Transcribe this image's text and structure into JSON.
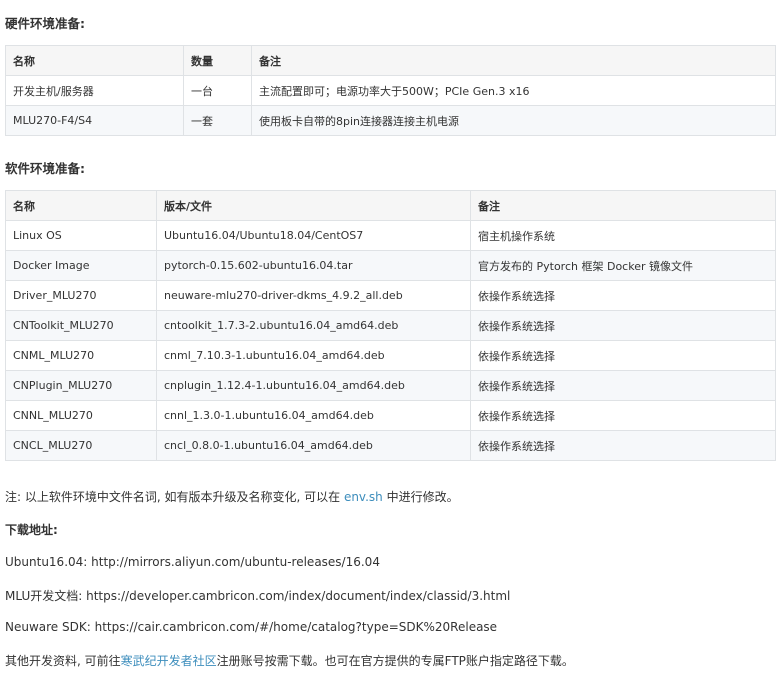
{
  "hardware": {
    "title": "硬件环境准备:",
    "columns": [
      "名称",
      "数量",
      "备注"
    ],
    "rows": [
      [
        "开发主机/服务器",
        "一台",
        "主流配置即可；电源功率大于500W；PCIe Gen.3 x16"
      ],
      [
        "MLU270-F4/S4",
        "一套",
        "使用板卡自带的8pin连接器连接主机电源"
      ]
    ]
  },
  "software": {
    "title": "软件环境准备:",
    "columns": [
      "名称",
      "版本/文件",
      "备注"
    ],
    "rows": [
      [
        "Linux OS",
        "Ubuntu16.04/Ubuntu18.04/CentOS7",
        "宿主机操作系统"
      ],
      [
        "Docker Image",
        "pytorch-0.15.602-ubuntu16.04.tar",
        "官方发布的 Pytorch 框架 Docker 镜像文件"
      ],
      [
        "Driver_MLU270",
        "neuware-mlu270-driver-dkms_4.9.2_all.deb",
        "依操作系统选择"
      ],
      [
        "CNToolkit_MLU270",
        "cntoolkit_1.7.3-2.ubuntu16.04_amd64.deb",
        "依操作系统选择"
      ],
      [
        "CNML_MLU270",
        "cnml_7.10.3-1.ubuntu16.04_amd64.deb",
        "依操作系统选择"
      ],
      [
        "CNPlugin_MLU270",
        "cnplugin_1.12.4-1.ubuntu16.04_amd64.deb",
        "依操作系统选择"
      ],
      [
        "CNNL_MLU270",
        "cnnl_1.3.0-1.ubuntu16.04_amd64.deb",
        "依操作系统选择"
      ],
      [
        "CNCL_MLU270",
        "cncl_0.8.0-1.ubuntu16.04_amd64.deb",
        "依操作系统选择"
      ]
    ]
  },
  "note": {
    "prefix": "注: 以上软件环境中文件名词, 如有版本升级及名称变化, 可以在 ",
    "link": "env.sh",
    "suffix": " 中进行修改。"
  },
  "downloads": {
    "title": "下载地址:",
    "ubuntu": "Ubuntu16.04: http://mirrors.aliyun.com/ubuntu-releases/16.04",
    "mlu_docs": "MLU开发文档: https://developer.cambricon.com/index/document/index/classid/3.html",
    "neuware": "Neuware SDK: https://cair.cambricon.com/#/home/catalog?type=SDK%20Release",
    "other_prefix": "其他开发资料, 可前往",
    "other_link": "寒武纪开发者社区",
    "other_suffix": "注册账号按需下载。也可在官方提供的专属FTP账户指定路径下载。"
  },
  "colors": {
    "link": "#3c8dbc",
    "border": "#dfe2e5",
    "header_bg": "#f6f6f6",
    "alt_row_bg": "#f6f8fa",
    "text": "#333333"
  }
}
